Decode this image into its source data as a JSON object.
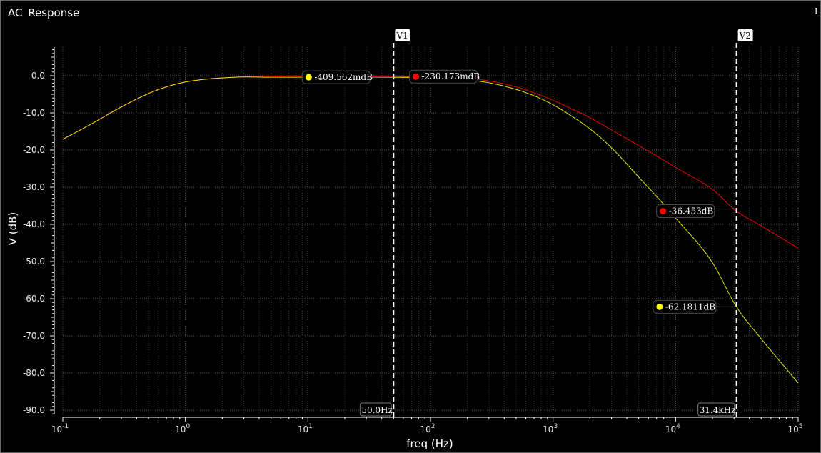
{
  "window": {
    "title": "AC Response",
    "page_number": "1"
  },
  "chart_data": {
    "type": "line",
    "title": "AC Response",
    "xlabel": "freq (Hz)",
    "ylabel": "V (dB)",
    "xscale": "log",
    "xlim": [
      0.1,
      100000
    ],
    "ylim": [
      -90,
      0
    ],
    "x_ticks": [
      {
        "base": "10",
        "exp": "-1"
      },
      {
        "base": "10",
        "exp": "0"
      },
      {
        "base": "10",
        "exp": "1"
      },
      {
        "base": "10",
        "exp": "2"
      },
      {
        "base": "10",
        "exp": "3"
      },
      {
        "base": "10",
        "exp": "4"
      },
      {
        "base": "10",
        "exp": "5"
      }
    ],
    "y_ticks": [
      "0.0",
      "-10.0",
      "-20.0",
      "-30.0",
      "-40.0",
      "-50.0",
      "-60.0",
      "-70.0",
      "-80.0",
      "-90.0"
    ],
    "grid": true,
    "background": "#000000",
    "series": [
      {
        "color": "#ff0000",
        "x": [
          0.1,
          0.15,
          0.2,
          0.3,
          0.5,
          0.7,
          1,
          1.5,
          2,
          3,
          5,
          7,
          10,
          20,
          50,
          100,
          150,
          200,
          300,
          500,
          700,
          1000,
          1500,
          2000,
          3000,
          5000,
          7000,
          10000,
          20000,
          31400,
          50000,
          70000,
          100000
        ],
        "y": [
          -17.1,
          -14.0,
          -11.7,
          -8.4,
          -4.8,
          -3.0,
          -1.7,
          -0.9,
          -0.6,
          -0.3,
          -0.12,
          -0.07,
          -0.05,
          -0.05,
          -0.1,
          -0.23,
          -0.42,
          -0.7,
          -1.4,
          -3.0,
          -4.6,
          -6.6,
          -9.3,
          -11.3,
          -14.6,
          -18.8,
          -21.6,
          -24.7,
          -30.6,
          -36.453,
          -40.4,
          -43.3,
          -46.4
        ]
      },
      {
        "color": "#ffff00",
        "x": [
          0.1,
          0.15,
          0.2,
          0.3,
          0.5,
          0.7,
          1,
          1.5,
          2,
          3,
          5,
          7,
          10,
          20,
          50,
          100,
          150,
          200,
          300,
          500,
          700,
          1000,
          1500,
          2000,
          3000,
          5000,
          7000,
          10000,
          20000,
          31400,
          50000,
          70000,
          100000
        ],
        "y": [
          -17.1,
          -14.0,
          -11.7,
          -8.4,
          -4.8,
          -3.0,
          -1.7,
          -0.9,
          -0.6,
          -0.35,
          -0.41,
          -0.41,
          -0.41,
          -0.41,
          -0.43,
          -0.6,
          -0.8,
          -1.1,
          -1.9,
          -3.7,
          -5.4,
          -7.8,
          -11.4,
          -14.3,
          -19.4,
          -27.3,
          -32.5,
          -38.3,
          -50.3,
          -62.1811,
          -70.8,
          -76.6,
          -82.7
        ]
      }
    ],
    "markers": [
      {
        "label": "-409.562mdB",
        "x": 10,
        "y": -0.41,
        "color": "#ffff00"
      },
      {
        "label": "-230.173mdB",
        "x": 75,
        "y": -0.23,
        "color": "#ff0000"
      },
      {
        "label": "-36.453dB",
        "x": 8000,
        "y": -36.453,
        "color": "#ff0000"
      },
      {
        "label": "-62.1811dB",
        "x": 7500,
        "y": -62.1811,
        "color": "#ffff00"
      }
    ],
    "cursors": [
      {
        "name": "V1",
        "x": 50.0,
        "readout": "50.0Hz"
      },
      {
        "name": "V2",
        "x": 31400,
        "readout": "31.4kHz"
      }
    ]
  }
}
